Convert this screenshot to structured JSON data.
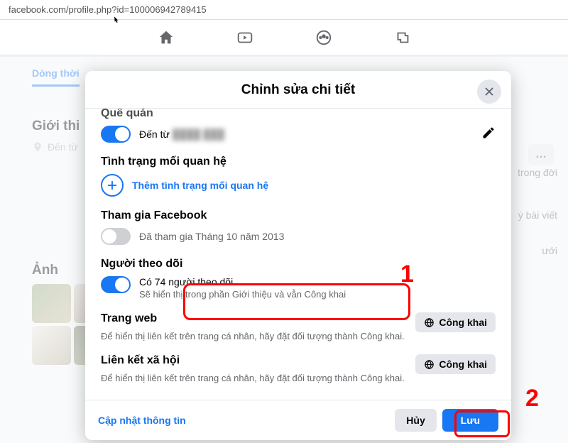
{
  "url": "facebook.com/profile.php?id=100006942789415",
  "background": {
    "tab_timeline": "Dòng thời",
    "section_about": "Giới thi",
    "row_from": "Đến từ",
    "label_indoi": "trong đời",
    "label_baiviet": "ý bài viết",
    "label_uoi": "ưới",
    "section_photos": "Ảnh",
    "more": "…"
  },
  "modal": {
    "title": "Chỉnh sửa chi tiết",
    "hometown": {
      "heading": "Quê quán",
      "text_prefix": "Đến từ",
      "text_hidden": "████ ███"
    },
    "relationship": {
      "heading": "Tình trạng mối quan hệ",
      "add_label": "Thêm tình trạng mối quan hệ"
    },
    "joined": {
      "heading": "Tham gia Facebook",
      "text": "Đã tham gia Tháng 10 năm 2013"
    },
    "followers": {
      "heading": "Người theo dõi",
      "text": "Có 74 người theo dõi",
      "sub": "Sẽ hiển thị trong phần Giới thiệu và vẫn Công khai"
    },
    "website": {
      "heading": "Trang web",
      "desc": "Để hiển thị liên kết trên trang cá nhân, hãy đặt đối tượng thành Công khai.",
      "privacy": "Công khai"
    },
    "social": {
      "heading": "Liên kết xã hội",
      "desc": "Để hiển thị liên kết trên trang cá nhân, hãy đặt đối tượng thành Công khai.",
      "privacy": "Công khai"
    },
    "footer": {
      "update": "Cập nhật thông tin",
      "cancel": "Hủy",
      "save": "Lưu"
    }
  },
  "annotations": {
    "one": "1",
    "two": "2"
  }
}
